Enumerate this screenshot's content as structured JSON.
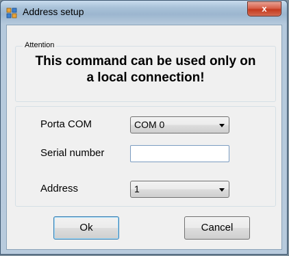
{
  "window": {
    "title": "Address setup",
    "close_label": "x"
  },
  "attention": {
    "legend": "Attention",
    "message_line1": "This command can be used only on",
    "message_line2": "a local connection!"
  },
  "form": {
    "porta_com_label": "Porta COM",
    "porta_com_value": "COM 0",
    "serial_label": "Serial number",
    "serial_value": "",
    "address_label": "Address",
    "address_value": "1"
  },
  "buttons": {
    "ok_label": "Ok",
    "cancel_label": "Cancel"
  },
  "icons": {
    "app": "app-window-icon",
    "dropdown": "chevron-down-icon"
  }
}
